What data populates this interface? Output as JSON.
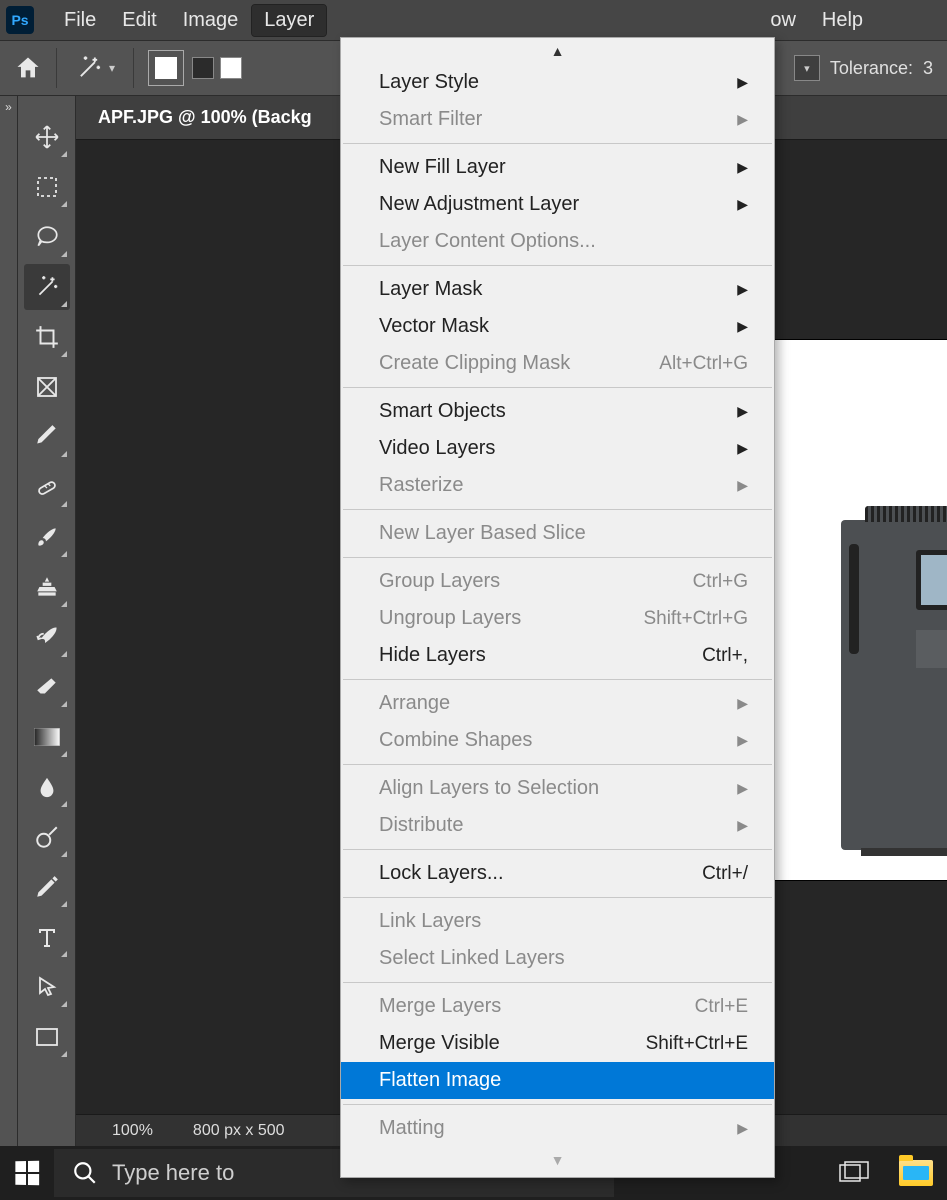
{
  "app": {
    "logo_text": "Ps"
  },
  "menubar": {
    "items": [
      "File",
      "Edit",
      "Image",
      "Layer",
      "ow",
      "Help"
    ],
    "open_index": 3
  },
  "options_bar": {
    "tolerance_label": "Tolerance:",
    "tolerance_value": "3"
  },
  "document": {
    "tab_title": "APF.JPG @ 100% (Backg",
    "zoom": "100%",
    "dimensions": "800 px x 500"
  },
  "tools": [
    {
      "name": "move-tool",
      "corner": true
    },
    {
      "name": "marquee-tool",
      "corner": true
    },
    {
      "name": "lasso-tool",
      "corner": true
    },
    {
      "name": "magic-wand-tool",
      "corner": true,
      "active": true
    },
    {
      "name": "crop-tool",
      "corner": true
    },
    {
      "name": "frame-tool",
      "corner": false
    },
    {
      "name": "eyedropper-tool",
      "corner": true
    },
    {
      "name": "healing-brush-tool",
      "corner": true
    },
    {
      "name": "brush-tool",
      "corner": true
    },
    {
      "name": "clone-stamp-tool",
      "corner": true
    },
    {
      "name": "history-brush-tool",
      "corner": true
    },
    {
      "name": "eraser-tool",
      "corner": true
    },
    {
      "name": "gradient-tool",
      "corner": true
    },
    {
      "name": "blur-tool",
      "corner": true
    },
    {
      "name": "dodge-tool",
      "corner": true
    },
    {
      "name": "pen-tool",
      "corner": true
    },
    {
      "name": "type-tool",
      "corner": true
    },
    {
      "name": "path-selection-tool",
      "corner": true
    },
    {
      "name": "rectangle-tool",
      "corner": true
    }
  ],
  "layer_menu": {
    "groups": [
      [
        {
          "label": "Layer Style",
          "submenu": true,
          "disabled": false
        },
        {
          "label": "Smart Filter",
          "submenu": true,
          "disabled": true
        }
      ],
      [
        {
          "label": "New Fill Layer",
          "submenu": true,
          "disabled": false
        },
        {
          "label": "New Adjustment Layer",
          "submenu": true,
          "disabled": false
        },
        {
          "label": "Layer Content Options...",
          "disabled": true
        }
      ],
      [
        {
          "label": "Layer Mask",
          "submenu": true,
          "disabled": false
        },
        {
          "label": "Vector Mask",
          "submenu": true,
          "disabled": false
        },
        {
          "label": "Create Clipping Mask",
          "shortcut": "Alt+Ctrl+G",
          "disabled": true
        }
      ],
      [
        {
          "label": "Smart Objects",
          "submenu": true,
          "disabled": false
        },
        {
          "label": "Video Layers",
          "submenu": true,
          "disabled": false
        },
        {
          "label": "Rasterize",
          "submenu": true,
          "disabled": true
        }
      ],
      [
        {
          "label": "New Layer Based Slice",
          "disabled": true
        }
      ],
      [
        {
          "label": "Group Layers",
          "shortcut": "Ctrl+G",
          "disabled": true
        },
        {
          "label": "Ungroup Layers",
          "shortcut": "Shift+Ctrl+G",
          "disabled": true
        },
        {
          "label": "Hide Layers",
          "shortcut": "Ctrl+,",
          "disabled": false
        }
      ],
      [
        {
          "label": "Arrange",
          "submenu": true,
          "disabled": true
        },
        {
          "label": "Combine Shapes",
          "submenu": true,
          "disabled": true
        }
      ],
      [
        {
          "label": "Align Layers to Selection",
          "submenu": true,
          "disabled": true
        },
        {
          "label": "Distribute",
          "submenu": true,
          "disabled": true
        }
      ],
      [
        {
          "label": "Lock Layers...",
          "shortcut": "Ctrl+/",
          "disabled": false
        }
      ],
      [
        {
          "label": "Link Layers",
          "disabled": true
        },
        {
          "label": "Select Linked Layers",
          "disabled": true
        }
      ],
      [
        {
          "label": "Merge Layers",
          "shortcut": "Ctrl+E",
          "disabled": true
        },
        {
          "label": "Merge Visible",
          "shortcut": "Shift+Ctrl+E",
          "disabled": false
        },
        {
          "label": "Flatten Image",
          "disabled": false,
          "selected": true
        }
      ],
      [
        {
          "label": "Matting",
          "submenu": true,
          "disabled": true
        }
      ]
    ]
  },
  "taskbar": {
    "search_placeholder": "Type here to"
  }
}
